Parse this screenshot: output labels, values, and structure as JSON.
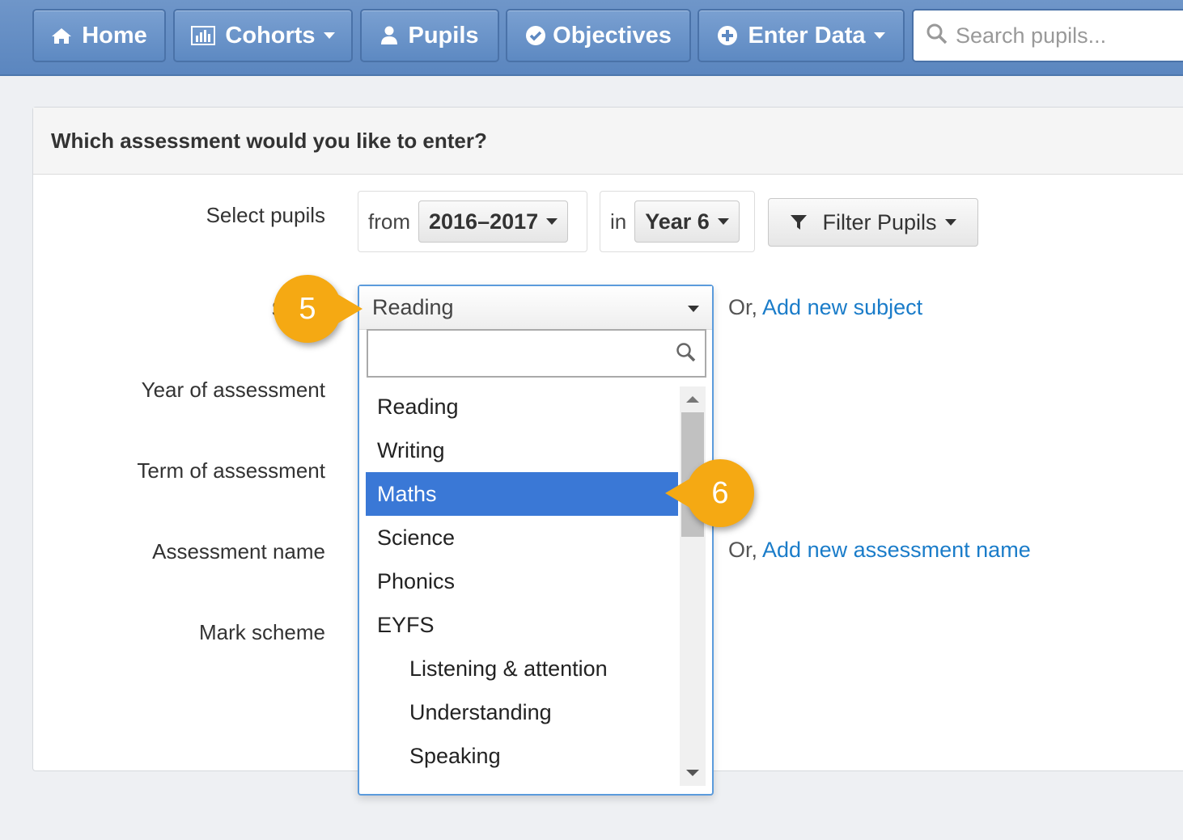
{
  "nav": {
    "home": "Home",
    "cohorts": "Cohorts",
    "pupils": "Pupils",
    "objectives": "Objectives",
    "enter_data": "Enter Data",
    "search_placeholder": "Search pupils..."
  },
  "panel": {
    "title": "Which assessment would you like to enter?"
  },
  "form": {
    "select_pupils_label": "Select pupils",
    "from_label": "from",
    "year_range": "2016–2017",
    "in_label": "in",
    "year_group": "Year 6",
    "filter_button": "Filter Pupils",
    "subject_label": "Subje",
    "year_of_assessment_label": "Year of assessment",
    "term_of_assessment_label": "Term of assessment",
    "assessment_name_label": "Assessment name",
    "mark_scheme_label": "Mark scheme",
    "or_text": "Or,",
    "add_subject_link": "Add new subject",
    "add_assessment_link": "Add new assessment name"
  },
  "subject_select": {
    "selected": "Reading",
    "search_value": "",
    "options": [
      {
        "label": "Reading",
        "indent": false,
        "active": false
      },
      {
        "label": "Writing",
        "indent": false,
        "active": false
      },
      {
        "label": "Maths",
        "indent": false,
        "active": true
      },
      {
        "label": "Science",
        "indent": false,
        "active": false
      },
      {
        "label": "Phonics",
        "indent": false,
        "active": false
      },
      {
        "label": "EYFS",
        "indent": false,
        "active": false
      },
      {
        "label": "Listening & attention",
        "indent": true,
        "active": false
      },
      {
        "label": "Understanding",
        "indent": true,
        "active": false
      },
      {
        "label": "Speaking",
        "indent": true,
        "active": false
      }
    ]
  },
  "callouts": {
    "step5": "5",
    "step6": "6"
  },
  "colors": {
    "nav_blue": "#5b86bf",
    "highlight": "#3a78d6",
    "link": "#1a7cc9",
    "callout": "#f5a913"
  }
}
